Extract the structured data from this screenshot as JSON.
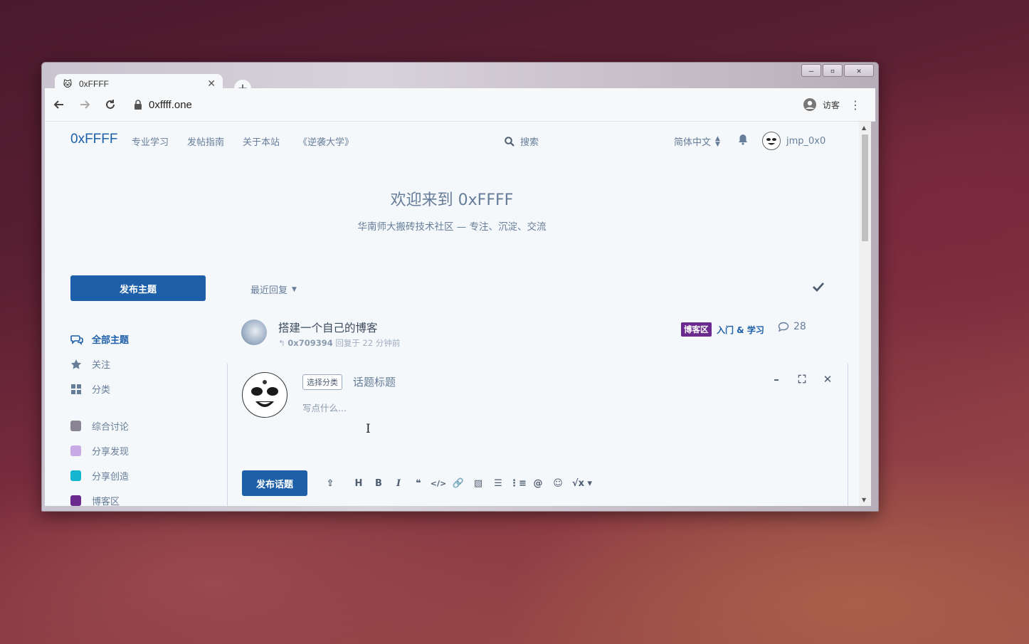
{
  "window": {
    "minimize_icon": "minimize-icon",
    "restore_icon": "restore-icon",
    "close_icon": "close-icon"
  },
  "browser": {
    "tab_title": "0xFFFF",
    "url": "0xffff.one",
    "profile_label": "访客"
  },
  "site": {
    "logo": "0xFFFF",
    "nav": [
      "专业学习",
      "发帖指南",
      "关于本站",
      "《逆袭大学》"
    ],
    "search_label": "搜索",
    "language": "简体中文",
    "username": "jmp_0x0"
  },
  "hero": {
    "title": "欢迎来到 0xFFFF",
    "subtitle": "华南师大搬砖技术社区 — 专注、沉淀、交流"
  },
  "sidebar": {
    "start_button": "发布主题",
    "items": [
      {
        "label": "全部主题",
        "icon": "comments-icon",
        "active": true
      },
      {
        "label": "关注",
        "icon": "star-icon"
      },
      {
        "label": "分类",
        "icon": "grid-icon"
      }
    ],
    "tags": [
      {
        "label": "综合讨论",
        "color": "#8a8595"
      },
      {
        "label": "分享发现",
        "color": "#c7a9e6"
      },
      {
        "label": "分享创造",
        "color": "#13b5d0"
      },
      {
        "label": "博客区",
        "color": "#6b2b8e"
      }
    ]
  },
  "list": {
    "sort_label": "最近回复",
    "discussions": [
      {
        "title": "搭建一个自己的博客",
        "last_user": "0x709394",
        "last_reply": "回复于 22 分钟前",
        "tag_primary": "博客区",
        "tag_secondary": "入门 & 学习",
        "reply_count": "28"
      }
    ]
  },
  "composer": {
    "category_button": "选择分类",
    "title_placeholder": "话题标题",
    "body_placeholder": "写点什么...",
    "submit_label": "发布话题",
    "toolbar_icons": [
      "upload-icon",
      "heading-icon",
      "bold-icon",
      "italic-icon",
      "quote-icon",
      "code-icon",
      "link-icon",
      "image-icon",
      "bullet-list-icon",
      "numbered-list-icon",
      "mention-icon",
      "emoji-icon",
      "math-icon"
    ]
  }
}
